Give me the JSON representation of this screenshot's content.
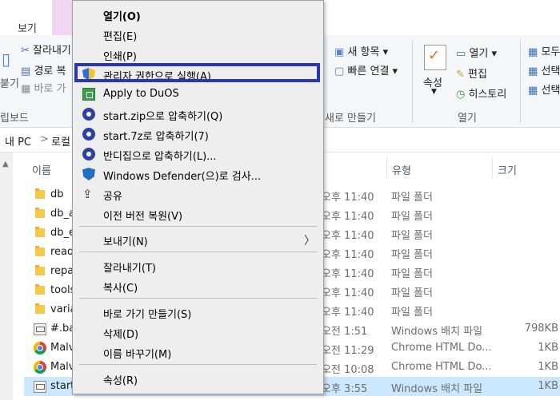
{
  "ribbon": {
    "tab_view": "보기",
    "left": {
      "cut": "잘라내기",
      "copy_path": "경로 복",
      "paste_shortcut": "바로 가",
      "partial_left": "붙기",
      "clipboard_group": "립보드"
    },
    "new": {
      "new_item": "새 항목 ▾",
      "easy_access": "빠른 연결 ▾",
      "group": "새로 만들기"
    },
    "open": {
      "properties": "속성",
      "open": "열기 ▾",
      "edit": "편집",
      "history": "히스토리",
      "group": "열기"
    },
    "select": {
      "select_all": "모두",
      "select_none": "선택",
      "invert": "선택"
    }
  },
  "address": {
    "pc": "내 PC",
    "sep": ">",
    "local": "로컬"
  },
  "columns": {
    "name": "이름",
    "type": "유형",
    "size": "크기"
  },
  "files": [
    {
      "name": "db",
      "date": "오후 11:40",
      "type": "파일 폴더",
      "size": "",
      "icon": "folder"
    },
    {
      "name": "db_a",
      "date": "오후 11:40",
      "type": "파일 폴더",
      "size": "",
      "icon": "folder"
    },
    {
      "name": "db_e",
      "date": "오후 11:40",
      "type": "파일 폴더",
      "size": "",
      "icon": "folder"
    },
    {
      "name": "read",
      "date": "오후 11:40",
      "type": "파일 폴더",
      "size": "",
      "icon": "folder"
    },
    {
      "name": "repa",
      "date": "오후 11:40",
      "type": "파일 폴더",
      "size": "",
      "icon": "folder"
    },
    {
      "name": "tools",
      "date": "오후 11:40",
      "type": "파일 폴더",
      "size": "",
      "icon": "folder"
    },
    {
      "name": "varia",
      "date": "오후 11:40",
      "type": "파일 폴더",
      "size": "",
      "icon": "folder"
    },
    {
      "name": "#.ba",
      "date": "오전 1:51",
      "type": "Windows 배치 파일",
      "size": "798KB",
      "icon": "bat"
    },
    {
      "name": "Malv",
      "date": "오전 11:29",
      "type": "Chrome HTML Do...",
      "size": "1KB",
      "icon": "chrome"
    },
    {
      "name": "Malv",
      "date": "오전 10:08",
      "type": "Chrome HTML Do...",
      "size": "1KB",
      "icon": "chrome"
    },
    {
      "name": "start",
      "date": "오후 3:55",
      "type": "Windows 배치 파일",
      "size": "1KB",
      "icon": "bat"
    }
  ],
  "context_menu": {
    "open": "열기(O)",
    "edit": "편집(E)",
    "print": "인쇄(P)",
    "run_as_admin": "관리자 권한으로 실행(A)",
    "apply_duos": "Apply to DuOS",
    "zip": "start.zip으로 압축하기(Q)",
    "sevenz": "start.7z로 압축하기(7)",
    "bandizip": "반디집으로 압축하기(L)...",
    "defender": "Windows Defender(으)로 검사...",
    "share": "공유",
    "restore": "이전 버전 복원(V)",
    "send_to": "보내기(N)",
    "cut": "잘라내기(T)",
    "copy": "복사(C)",
    "shortcut": "바로 가기 만들기(S)",
    "delete": "삭제(D)",
    "rename": "이름 바꾸기(M)",
    "properties": "속성(R)"
  },
  "colors": {
    "highlight_border": "#2b35b8",
    "selected_row": "#cce8ff",
    "menu_bg": "#eeeeee"
  }
}
